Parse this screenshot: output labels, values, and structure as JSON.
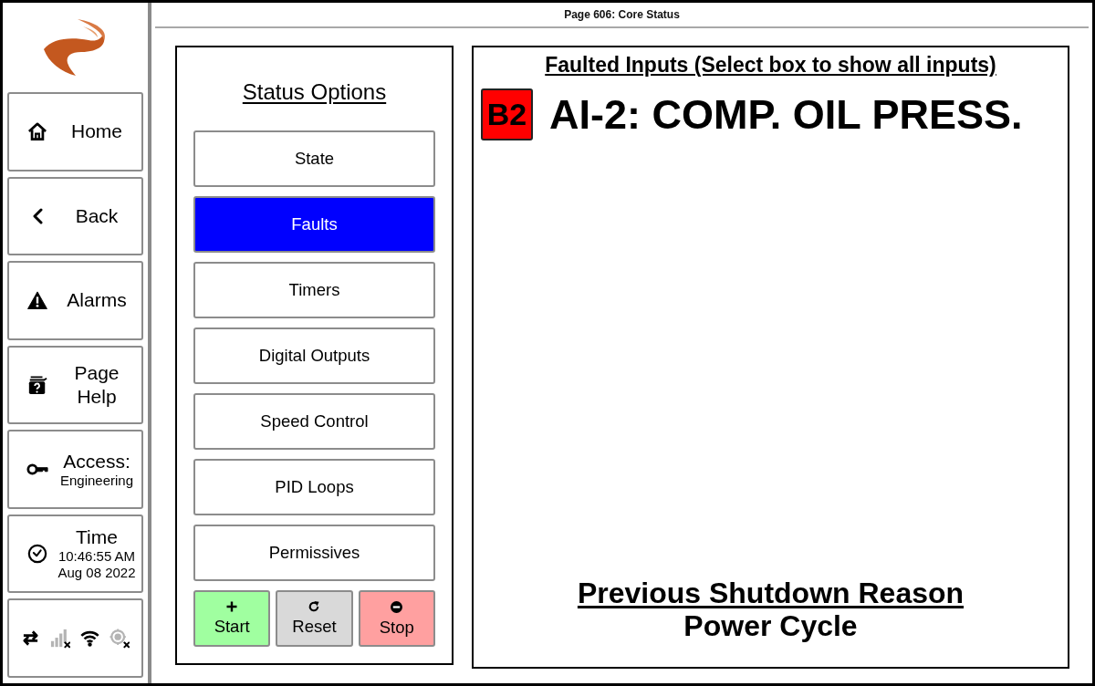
{
  "sidebar": {
    "items": [
      {
        "kind": "nav",
        "label": "Home"
      },
      {
        "kind": "nav",
        "label": "Back"
      },
      {
        "kind": "nav",
        "label": "Alarms"
      },
      {
        "kind": "nav",
        "label": "Page Help"
      },
      {
        "kind": "info",
        "label": "Access:",
        "values": [
          "Engineering"
        ]
      },
      {
        "kind": "info",
        "label": "Time",
        "values": [
          "10:46:55 AM",
          "Aug 08 2022"
        ]
      }
    ],
    "status_icons": [
      {
        "on": true
      },
      {
        "on": false
      },
      {
        "on": true
      },
      {
        "on": false
      }
    ]
  },
  "header": {
    "title": "Page 606: Core Status"
  },
  "status_options": {
    "title": "Status Options",
    "items": [
      {
        "label": "State",
        "selected": false
      },
      {
        "label": "Faults",
        "selected": true
      },
      {
        "label": "Timers",
        "selected": false
      },
      {
        "label": "Digital Outputs",
        "selected": false
      },
      {
        "label": "Speed Control",
        "selected": false
      },
      {
        "label": "PID Loops",
        "selected": false
      },
      {
        "label": "Permissives",
        "selected": false
      }
    ],
    "actions": [
      {
        "label": "Start",
        "color": "#a0ffa0"
      },
      {
        "label": "Reset",
        "color": "#d9d9d9"
      },
      {
        "label": "Stop",
        "color": "#ffa0a0"
      }
    ]
  },
  "faulted_inputs": {
    "title": "Faulted Inputs (Select box to show all inputs)",
    "faults": [
      {
        "code": "B2",
        "color": "#ff0000",
        "description": "AI-2: COMP. OIL PRESS."
      }
    ]
  },
  "shutdown": {
    "title": "Previous Shutdown Reason",
    "reason": "Power Cycle"
  }
}
